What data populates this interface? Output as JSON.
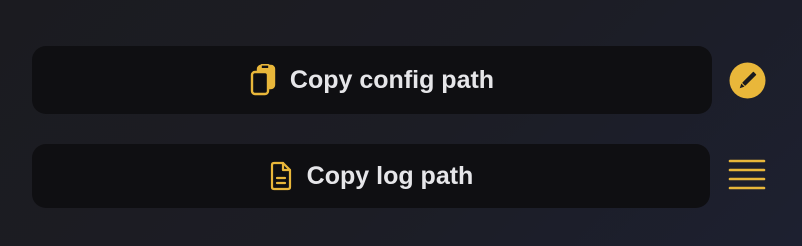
{
  "buttons": {
    "copy_config": {
      "label": "Copy config path",
      "icon": "clipboard-copy-icon"
    },
    "copy_log": {
      "label": "Copy log path",
      "icon": "document-icon"
    }
  },
  "side_actions": {
    "edit": {
      "icon": "pencil-icon"
    },
    "menu": {
      "icon": "menu-icon"
    }
  },
  "colors": {
    "accent": "#e9b73a",
    "button_bg": "#0f0f12",
    "text": "#e6e6e9"
  }
}
